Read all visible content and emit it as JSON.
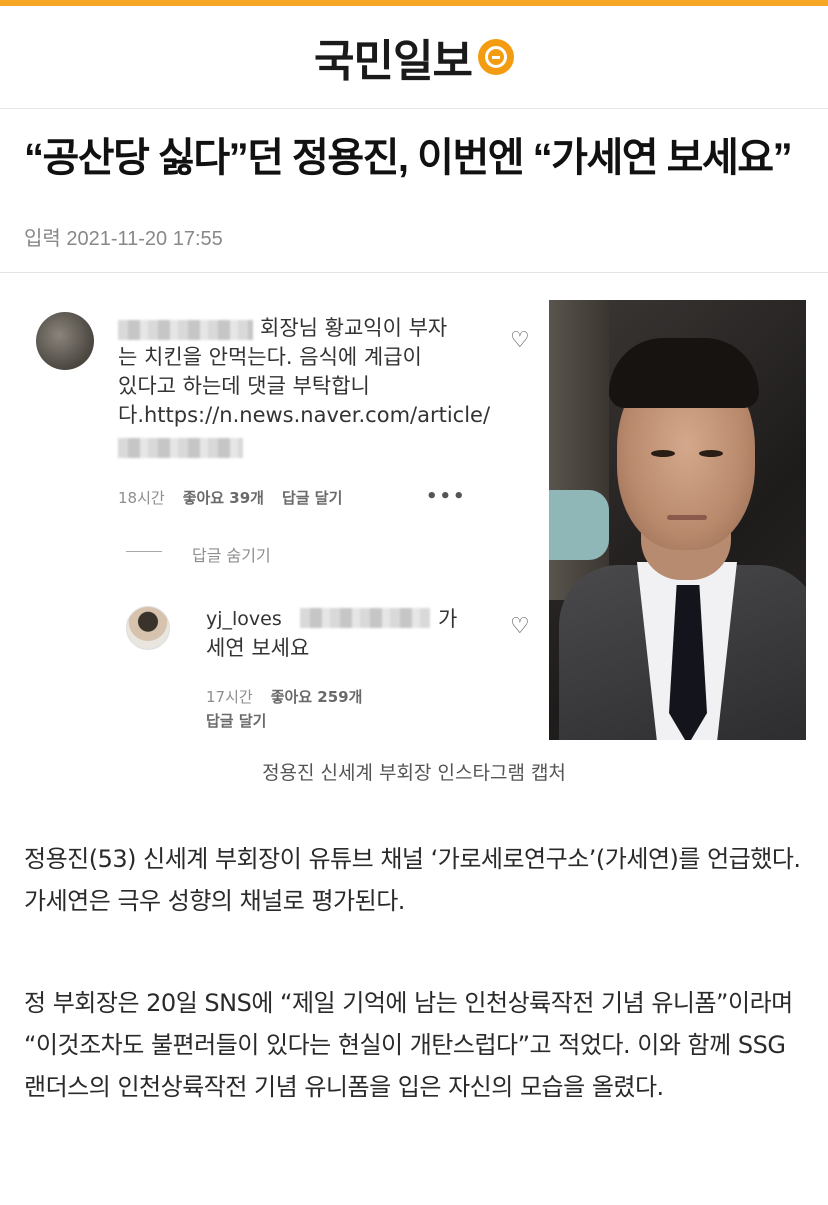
{
  "masthead": {
    "brand": "국민일보",
    "logo_icon": "kmib-circle-logo",
    "accent": "#f39c12",
    "topbar_color": "#f5a623"
  },
  "article": {
    "headline": "“공산당 싫다”던 정용진, 이번엔 “가세연 보세요”",
    "dateline": "입력 2021-11-20 17:55",
    "caption": "정용진 신세계 부회장 인스타그램 캡처",
    "paragraphs": [
      "정용진(53) 신세계 부회장이 유튜브 채널 ‘가로세로연구소’(가세연)를 언급했다. 가세연은 극우 성향의 채널로 평가된다.",
      "정 부회장은 20일 SNS에 “제일 기억에 남는 인천상륙작전 기념 유니폼”이라며 “이것조차도 불편러들이 있다는 현실이 개탄스럽다”고 적었다. 이와 함께 SSG랜더스의 인천상륙작전 기념 유니폼을 입은 자신의 모습을 올렸다."
    ]
  },
  "instagram": {
    "comment": {
      "lines": [
        "회장님 황교익이 부자",
        "는 치킨을 안먹는다. 음식에 계급이",
        "있다고 하는데 댓글 부탁합니",
        "다.https://n.news.naver.com/article/"
      ],
      "time": "18시간",
      "likes": "좋아요 39개",
      "reply": "답글 달기",
      "more": "•••"
    },
    "hide_replies": "답글 숨기기",
    "reply": {
      "username": "yj_loves",
      "text_tail": "가",
      "text_line2": "세연 보세요",
      "time": "17시간",
      "likes": "좋아요 259개",
      "reply": "답글 달기"
    },
    "heart_icon": "♡"
  }
}
